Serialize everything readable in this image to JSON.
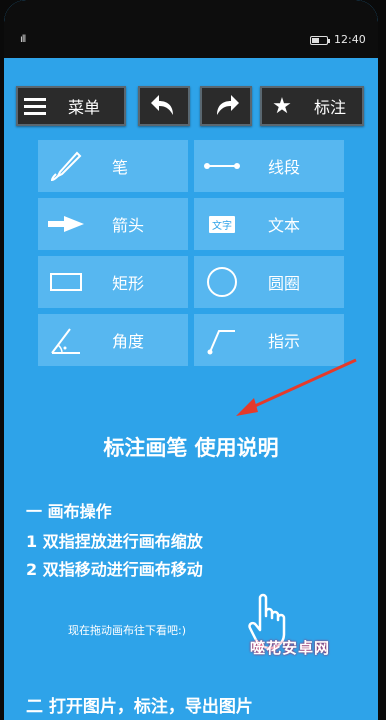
{
  "statusbar": {
    "signal": "ıll",
    "time": "12:40"
  },
  "toolbar": {
    "menu_label": "菜单",
    "mark_label": "标注"
  },
  "tools": [
    {
      "label": "笔",
      "icon": "pen-icon"
    },
    {
      "label": "线段",
      "icon": "line-segment-icon"
    },
    {
      "label": "箭头",
      "icon": "arrow-icon"
    },
    {
      "label": "文本",
      "icon": "text-icon",
      "icon_text": "文字"
    },
    {
      "label": "矩形",
      "icon": "rectangle-icon"
    },
    {
      "label": "圆圈",
      "icon": "circle-icon"
    },
    {
      "label": "角度",
      "icon": "angle-icon"
    },
    {
      "label": "指示",
      "icon": "pointer-icon"
    }
  ],
  "guide": {
    "title": "标注画笔  使用说明",
    "section1_heading": "一  画布操作",
    "step1": "1  双指捏放进行画布缩放",
    "step2": "2  双指移动进行画布移动",
    "hint": "现在拖动画布往下看吧:)",
    "section2_heading": "二  打开图片，标注，导出图片"
  },
  "watermark": "噬花安卓网",
  "colors": {
    "background": "#2ea3e9",
    "tile": "#57b7f0",
    "toolbar_button": "#2b2b2b",
    "arrow": "#e53a2b"
  }
}
